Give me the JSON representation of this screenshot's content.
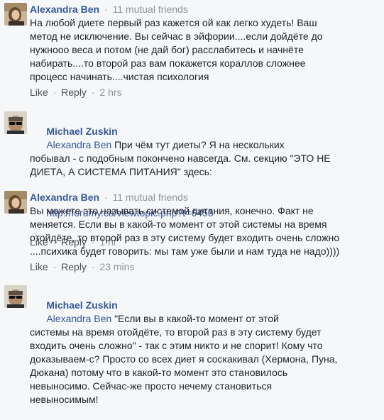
{
  "comments": [
    {
      "author": "Alexandra Ben",
      "meta": "11 mutual friends",
      "text": "На любой диете первый раз кажется ой как легко худеть! Ваш\nметод не исключение. Вы сейчас в эйфории....если дойдёте до\nнужнооо веса и потом (не дай бог) расслабитесь и начнёте\nнабирать....то второй раз вам покажется кораллов сложнее\nпроцесс начинать....чистая психология",
      "like": "Like",
      "reply": "Reply",
      "time": "2 hrs"
    },
    {
      "author": "Michael Zuskin",
      "mention": "Alexandra Ben",
      "text": " При чём тут диеты? Я на нескольких\nпобывал - с подобным покончено навсегда. См. секцию \"ЭТО НЕ\nДИЕТА, А СИСТЕМА ПИТАНИЯ\" здесь:",
      "link": "http://forumy.ca/viewtopic.php?t=6453",
      "like": "Like",
      "reply": "Reply",
      "time": "1 hr"
    },
    {
      "author": "Alexandra Ben",
      "meta": "11 mutual friends",
      "text": "Вы можете это называть системой питания, конечно. Факт не\nменяется. Если вы в какой-то момент от этой системы на время\nотойдёте, то второй раз в эту систему будет входить очень сложно\n....психика будет говорить: мы там уже были и нам туда не надо))))",
      "like": "Like",
      "reply": "Reply",
      "time": "23 mins"
    },
    {
      "author": "Michael Zuskin",
      "mention": "Alexandra Ben",
      "text": " \"Если вы в какой-то момент от этой\nсистемы на время отойдёте, то второй раз в эту систему будет\nвходить очень сложно\" - так с этим никто и не спорит! Кому что\nдоказываем-с? Просто со всех диет я соскакивал (Хермона, Пуна,\nДюкана) потому что в какой-то момент это становилось\nневыносимо. Сейчас-же просто нечему становиться\nневыносимым!"
    }
  ],
  "icons": {
    "alexandra_avatar": "woman-photo-avatar",
    "michael_avatar": "man-with-sunglasses-avatar"
  },
  "colors": {
    "background": "#f6f7f9",
    "name": "#365899",
    "meta": "#90949c",
    "text": "#1d2129"
  }
}
